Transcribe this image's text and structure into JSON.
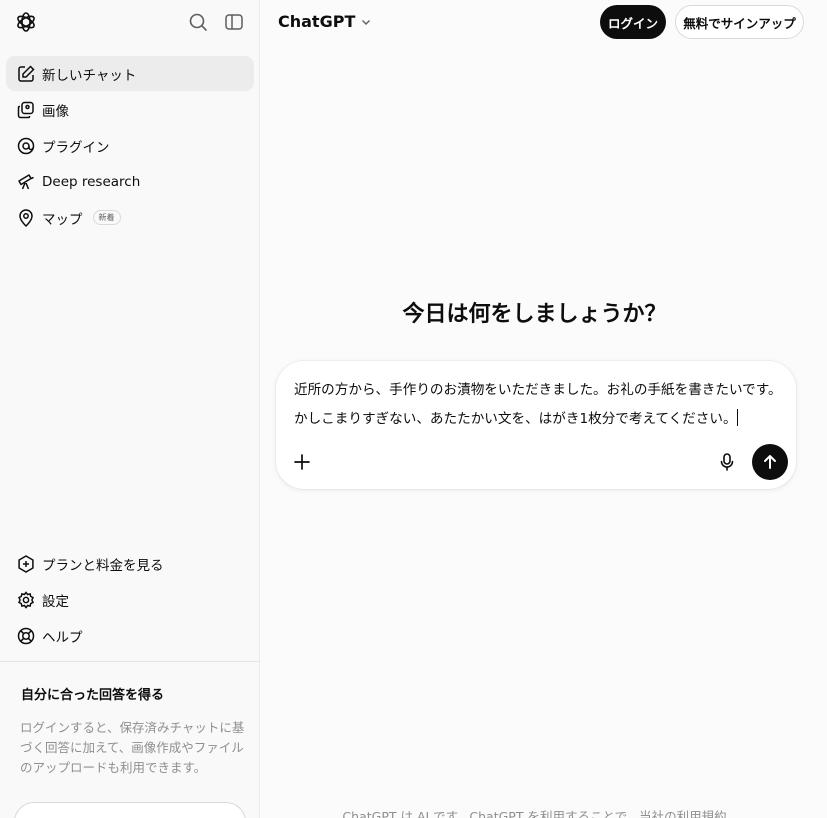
{
  "sidebar": {
    "logo_icon": "openai-logo-icon",
    "search_icon": "search-icon",
    "toggle_icon": "sidebar-toggle-icon",
    "items": [
      {
        "label": "新しいチャット",
        "icon": "edit-icon",
        "active": true
      },
      {
        "label": "画像",
        "icon": "images-icon"
      },
      {
        "label": "プラグイン",
        "icon": "plugin-icon"
      },
      {
        "label": "Deep research",
        "icon": "telescope-icon"
      },
      {
        "label": "マップ",
        "icon": "map-pin-icon",
        "badge": "新着"
      }
    ],
    "bottom_items": [
      {
        "label": "プランと料金を見る",
        "icon": "sparkle-icon"
      },
      {
        "label": "設定",
        "icon": "gear-icon"
      },
      {
        "label": "ヘルプ",
        "icon": "lifebuoy-icon"
      }
    ],
    "promo": {
      "title": "自分に合った回答を得る",
      "body": "ログインすると、保存済みチャットに基づく回答に加えて、画像作成やファイルのアップロードも利用できます。"
    }
  },
  "header": {
    "model_name": "ChatGPT",
    "login_label": "ログイン",
    "signup_label": "無料でサインアップ"
  },
  "main": {
    "headline": "今日は何をしましょうか？",
    "composer_text": "近所の方から、手作りのお漬物をいただきました。お礼の手紙を書きたいです。かしこまりすぎない、あたたかい文を、はがき1枚分で考えてください。",
    "footer_note": "ChatGPT は AI です。ChatGPT を利用することで、当社の利用規約"
  },
  "colors": {
    "accent": "#0d0d0d",
    "sidebar_bg": "#f9f9f9",
    "muted_text": "#8f8f8f"
  }
}
